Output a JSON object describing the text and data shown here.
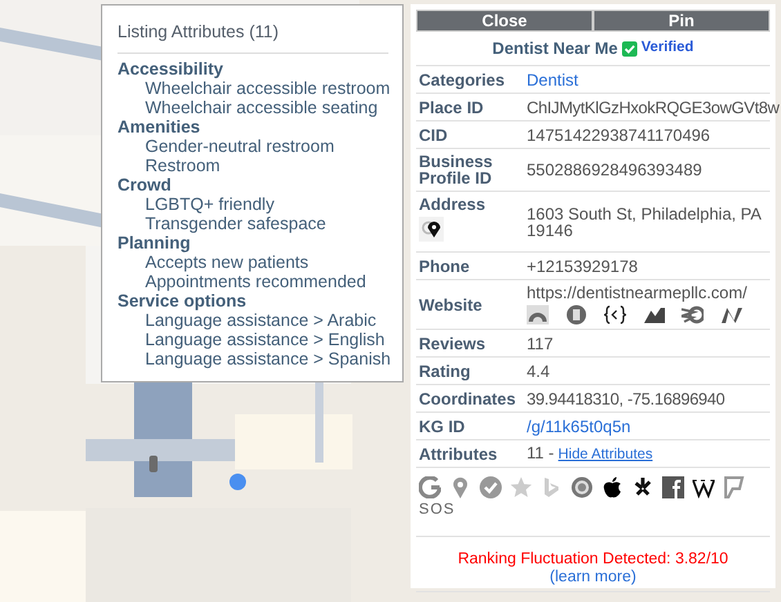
{
  "popup": {
    "title": "Listing Attributes (11)",
    "groups": [
      {
        "heading": "Accessibility",
        "items": [
          "Wheelchair accessible restroom",
          "Wheelchair accessible seating"
        ]
      },
      {
        "heading": "Amenities",
        "items": [
          "Gender-neutral restroom",
          "Restroom"
        ]
      },
      {
        "heading": "Crowd",
        "items": [
          "LGBTQ+ friendly",
          "Transgender safespace"
        ]
      },
      {
        "heading": "Planning",
        "items": [
          "Accepts new patients",
          "Appointments recommended"
        ]
      },
      {
        "heading": "Service options",
        "items": [
          "Language assistance > Arabic",
          "Language assistance > English",
          "Language assistance > Spanish"
        ]
      }
    ]
  },
  "panel": {
    "buttons": [
      "Close",
      "Pin"
    ],
    "name": "Dentist Near Me",
    "verified": true,
    "verified_label": "Verified",
    "rows": [
      {
        "label": "Categories",
        "value": "Dentist",
        "kind": "link"
      },
      {
        "label": "Place ID",
        "value": "ChIJMytKlGzHxokRQGE3owGVt8w",
        "kind": "text"
      },
      {
        "label": "CID",
        "value": "14751422938741170496",
        "kind": "text"
      },
      {
        "label": "Business Profile ID",
        "value": "5502886928496393489",
        "kind": "text"
      },
      {
        "label": "Address",
        "value": "1603 South St, Philadelphia, PA 19146",
        "kind": "address"
      },
      {
        "label": "Phone",
        "value": "+12153929178",
        "kind": "text"
      },
      {
        "label": "Website",
        "value": "https://dentistnearmepllc.com/",
        "kind": "website"
      },
      {
        "label": "Reviews",
        "value": "117",
        "kind": "text"
      },
      {
        "label": "Rating",
        "value": "4.4",
        "kind": "text"
      },
      {
        "label": "Coordinates",
        "value": "39.94418310, -75.16896940",
        "kind": "text"
      },
      {
        "label": "KG ID",
        "value": "/g/11k65t0q5n",
        "kind": "link"
      },
      {
        "label": "Attributes",
        "value": "11 -",
        "link": "Hide Attributes",
        "kind": "attributes"
      }
    ],
    "sos": "SOS",
    "alert": "Ranking Fluctuation Detected: 3.82/10",
    "learn_more": "(learn more)"
  }
}
